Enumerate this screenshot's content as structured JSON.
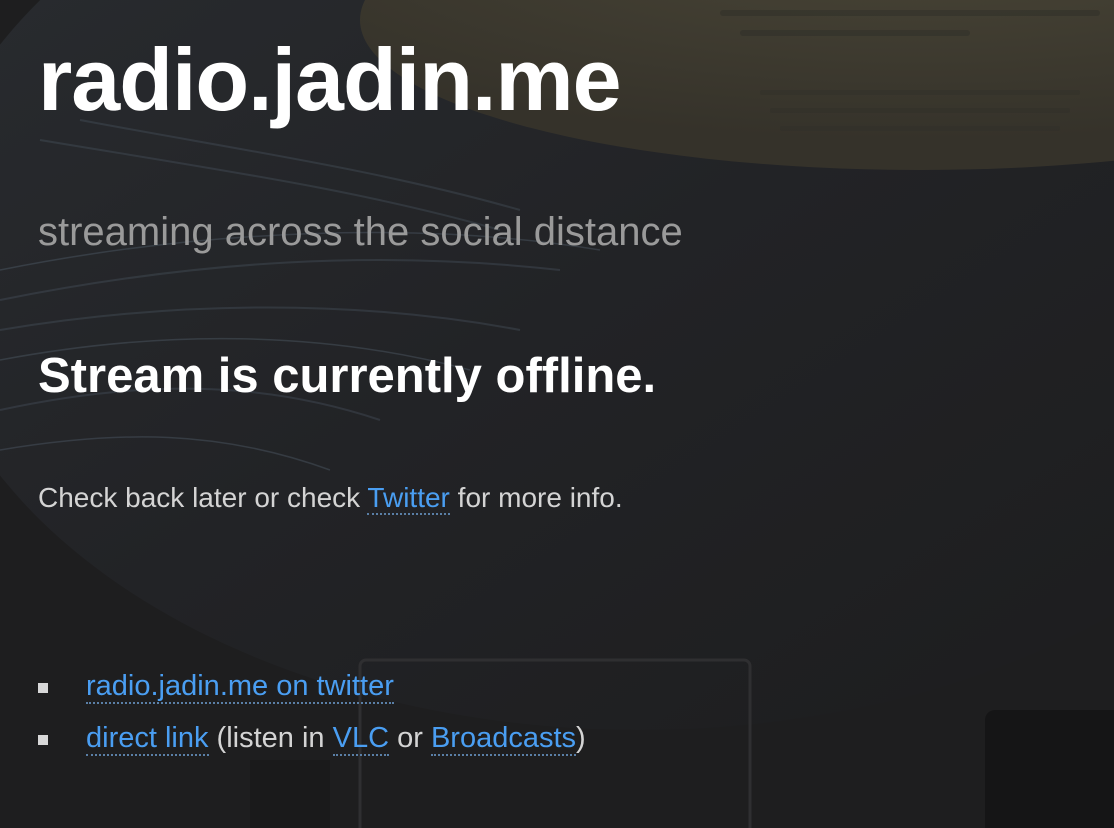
{
  "header": {
    "site_title": "radio.jadin.me",
    "tagline": "streaming across the social distance"
  },
  "status": {
    "message": "Stream is currently offline."
  },
  "info": {
    "prefix": "Check back later or check ",
    "twitter_link": "Twitter",
    "suffix": " for more info."
  },
  "links": {
    "item1": {
      "link": "radio.jadin.me on twitter"
    },
    "item2": {
      "direct_link": "direct link",
      "text_listen": " (listen in ",
      "vlc_link": "VLC",
      "text_or": " or ",
      "broadcasts_link": "Broadcasts",
      "text_close": ")"
    }
  },
  "colors": {
    "background": "#1f1f20",
    "link": "#4a9ef2",
    "tagline": "#9a9a9a",
    "text": "#d4d4d4"
  }
}
